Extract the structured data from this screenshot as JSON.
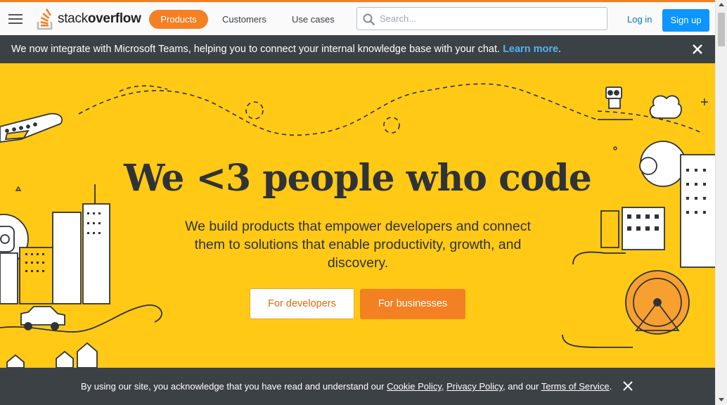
{
  "header": {
    "logo_prefix": "stack",
    "logo_bold": "overflow",
    "nav": {
      "products": "Products",
      "customers": "Customers",
      "use_cases": "Use cases"
    },
    "search_placeholder": "Search...",
    "login": "Log in",
    "signup": "Sign up"
  },
  "notice": {
    "text": "We now integrate with Microsoft Teams, helping you to connect your internal knowledge base with your chat.",
    "link": "Learn more",
    "trailing": "."
  },
  "hero": {
    "title": "We <3 people who code",
    "subtitle": "We build products that empower developers and connect them to solutions that enable productivity, growth, and discovery.",
    "btn_developers": "For developers",
    "btn_businesses": "For businesses"
  },
  "cookie": {
    "text1": "By using our site, you acknowledge that you have read and understand our ",
    "cookie_policy": "Cookie Policy",
    "sep1": ", ",
    "privacy_policy": "Privacy Policy",
    "sep2": ", and our ",
    "terms": "Terms of Service",
    "end": "."
  },
  "colors": {
    "accent": "#f48024",
    "hero_bg": "#ffc916",
    "banner_bg": "#3c4146",
    "link": "#0077cc",
    "signup_bg": "#0a95ff"
  },
  "icons": [
    "hamburger-icon",
    "stackoverflow-logo",
    "search-icon",
    "close-icon"
  ]
}
